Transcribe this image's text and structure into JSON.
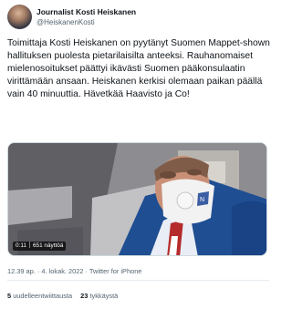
{
  "author": {
    "display_name": "Journalist Kosti Heiskanen",
    "handle": "@HeiskanenKosti"
  },
  "tweet": {
    "text": "Toimittaja Kosti Heiskanen on pyytänyt Suomen Mappet-shown hallituksen puolesta pietarilaisilta anteeksi. Rauhanomaiset mielenosoitukset päättyi ikävästi Suomen pääkonsulaatin virittämään ansaan. Heiskanen kerkisi olemaan paikan päällä vain 40 minuuttia. Hävetkää Haavisto ja Co!"
  },
  "media": {
    "type": "video",
    "duration": "0:11",
    "views": "651 näyttöä"
  },
  "meta": {
    "time": "12.39 ap.",
    "separator": "·",
    "date": "4. lokak. 2022",
    "source": "Twitter for iPhone"
  },
  "stats": {
    "retweets_count": "5",
    "retweets_label": "uudelleentwiittausta",
    "likes_count": "23",
    "likes_label": "tykkäystä"
  }
}
